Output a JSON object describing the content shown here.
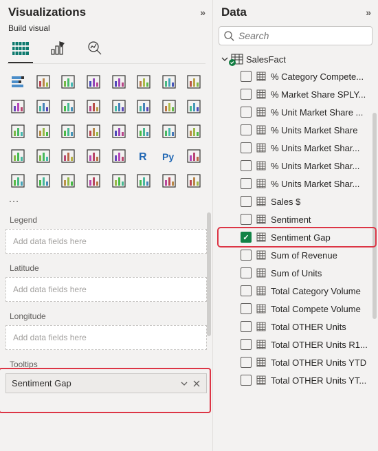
{
  "viz": {
    "title": "Visualizations",
    "subtitle": "Build visual",
    "more": "…",
    "types": [
      "stacked-bar",
      "stacked-column",
      "clustered-bar",
      "clustered-column",
      "100-bar",
      "100-column",
      "line",
      "area",
      "stacked-area",
      "line-stacked",
      "line-column",
      "ribbon",
      "waterfall",
      "funnel",
      "scatter",
      "pie",
      "donut",
      "treemap",
      "map",
      "filled-map",
      "azure-map",
      "shape-map",
      "gauge",
      "card",
      "multi-card",
      "kpi",
      "slicer",
      "table",
      "matrix",
      "r",
      "py",
      "key-influencers",
      "decomposition",
      "qa",
      "smart-narrative",
      "metrics",
      "paginated",
      "power-apps",
      "power-automate",
      "more-viz"
    ],
    "wells": [
      {
        "label": "Legend",
        "placeholder": "Add data fields here",
        "value": null
      },
      {
        "label": "Latitude",
        "placeholder": "Add data fields here",
        "value": null
      },
      {
        "label": "Longitude",
        "placeholder": "Add data fields here",
        "value": null
      },
      {
        "label": "Tooltips",
        "placeholder": "Add data fields here",
        "value": "Sentiment Gap"
      }
    ]
  },
  "data": {
    "title": "Data",
    "search_placeholder": "Search",
    "table_name": "SalesFact",
    "fields": [
      {
        "label": "% Category Compete...",
        "checked": false
      },
      {
        "label": "% Market Share SPLY...",
        "checked": false
      },
      {
        "label": "% Unit Market Share ...",
        "checked": false
      },
      {
        "label": "% Units Market Share",
        "checked": false
      },
      {
        "label": "% Units Market Shar...",
        "checked": false
      },
      {
        "label": "% Units Market Shar...",
        "checked": false
      },
      {
        "label": "% Units Market Shar...",
        "checked": false
      },
      {
        "label": "Sales $",
        "checked": false
      },
      {
        "label": "Sentiment",
        "checked": false
      },
      {
        "label": "Sentiment Gap",
        "checked": true,
        "highlight": true
      },
      {
        "label": "Sum of Revenue",
        "checked": false
      },
      {
        "label": "Sum of Units",
        "checked": false
      },
      {
        "label": "Total Category Volume",
        "checked": false
      },
      {
        "label": "Total Compete Volume",
        "checked": false
      },
      {
        "label": "Total OTHER Units",
        "checked": false
      },
      {
        "label": "Total OTHER Units R1...",
        "checked": false
      },
      {
        "label": "Total OTHER Units YTD",
        "checked": false
      },
      {
        "label": "Total OTHER Units YT...",
        "checked": false
      }
    ]
  }
}
